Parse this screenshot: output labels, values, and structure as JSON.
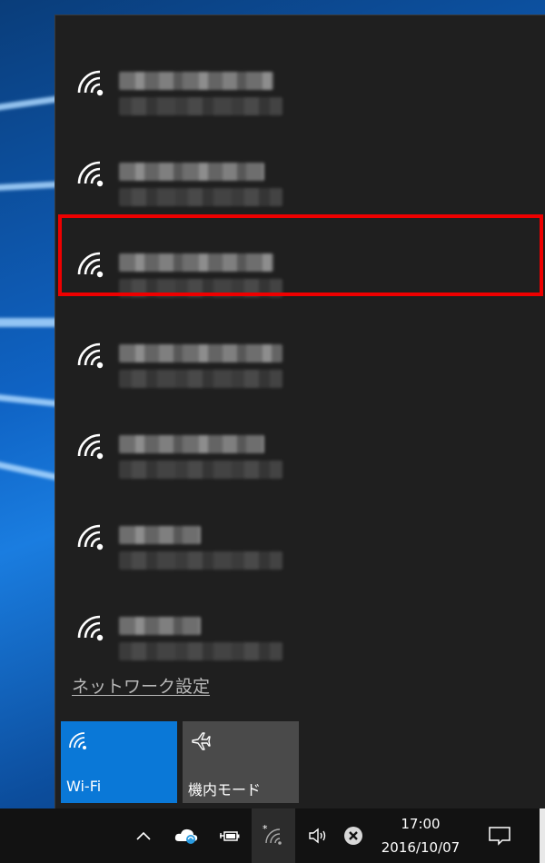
{
  "networks": [
    {
      "icon": "wifi-icon"
    },
    {
      "icon": "wifi-icon"
    },
    {
      "icon": "wifi-icon",
      "highlighted": true
    },
    {
      "icon": "wifi-icon"
    },
    {
      "icon": "wifi-icon"
    },
    {
      "icon": "wifi-icon"
    },
    {
      "icon": "wifi-icon"
    }
  ],
  "settings_link": "ネットワーク設定",
  "quick_actions": {
    "wifi": {
      "label": "Wi-Fi",
      "icon": "wifi-icon",
      "state": "on",
      "color": "#0a78d7"
    },
    "airplane": {
      "label": "機内モード",
      "icon": "airplane-icon",
      "state": "off",
      "color": "#4a4a4a"
    }
  },
  "taskbar": {
    "time": "17:00",
    "date": "2016/10/07",
    "tray_icons": [
      "chevron-up-icon",
      "onedrive-sync-icon",
      "power-icon",
      "network-icon",
      "volume-icon",
      "error-icon",
      "action-center-icon"
    ]
  },
  "colors": {
    "highlight": "#ee0000",
    "accent": "#0a78d7",
    "flyout_bg": "#1f1f1f"
  }
}
